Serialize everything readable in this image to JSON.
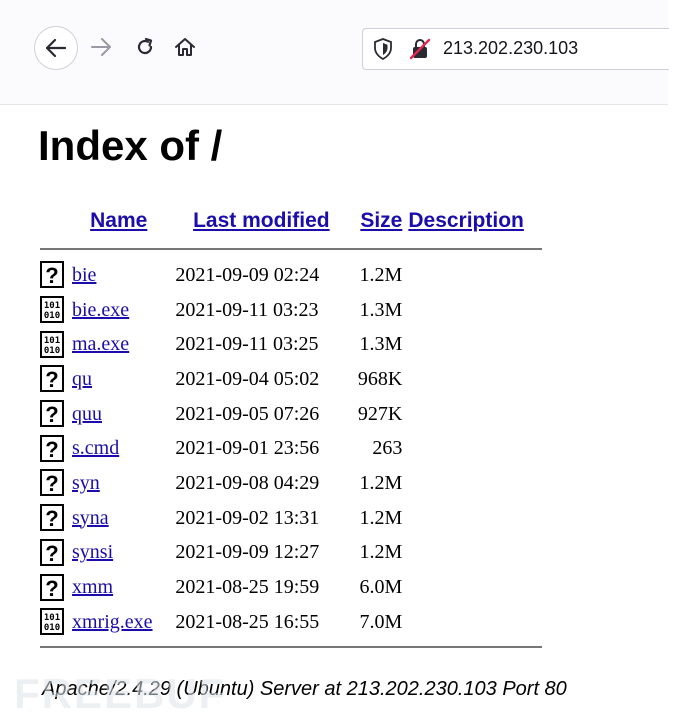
{
  "browser": {
    "url": "213.202.230.103"
  },
  "page": {
    "title": "Index of /",
    "columns": {
      "name": "Name",
      "last_modified": "Last modified",
      "size": "Size",
      "description": "Description"
    },
    "files": [
      {
        "name": "bie",
        "modified": "2021-09-09 02:24",
        "size": "1.2M",
        "icon": "unknown-file-icon"
      },
      {
        "name": "bie.exe",
        "modified": "2021-09-11 03:23",
        "size": "1.3M",
        "icon": "binary-file-icon"
      },
      {
        "name": "ma.exe",
        "modified": "2021-09-11 03:25",
        "size": "1.3M",
        "icon": "binary-file-icon"
      },
      {
        "name": "qu",
        "modified": "2021-09-04 05:02",
        "size": "968K",
        "icon": "unknown-file-icon"
      },
      {
        "name": "quu",
        "modified": "2021-09-05 07:26",
        "size": "927K",
        "icon": "unknown-file-icon"
      },
      {
        "name": "s.cmd",
        "modified": "2021-09-01 23:56",
        "size": "263",
        "icon": "unknown-file-icon"
      },
      {
        "name": "syn",
        "modified": "2021-09-08 04:29",
        "size": "1.2M",
        "icon": "unknown-file-icon"
      },
      {
        "name": "syna",
        "modified": "2021-09-02 13:31",
        "size": "1.2M",
        "icon": "unknown-file-icon"
      },
      {
        "name": "synsi",
        "modified": "2021-09-09 12:27",
        "size": "1.2M",
        "icon": "unknown-file-icon"
      },
      {
        "name": "xmm",
        "modified": "2021-08-25 19:59",
        "size": "6.0M",
        "icon": "unknown-file-icon"
      },
      {
        "name": "xmrig.exe",
        "modified": "2021-08-25 16:55",
        "size": "7.0M",
        "icon": "binary-file-icon"
      }
    ],
    "footer": "Apache/2.4.29 (Ubuntu) Server at 213.202.230.103 Port 80"
  },
  "colors": {
    "link": "#1a0dab"
  }
}
